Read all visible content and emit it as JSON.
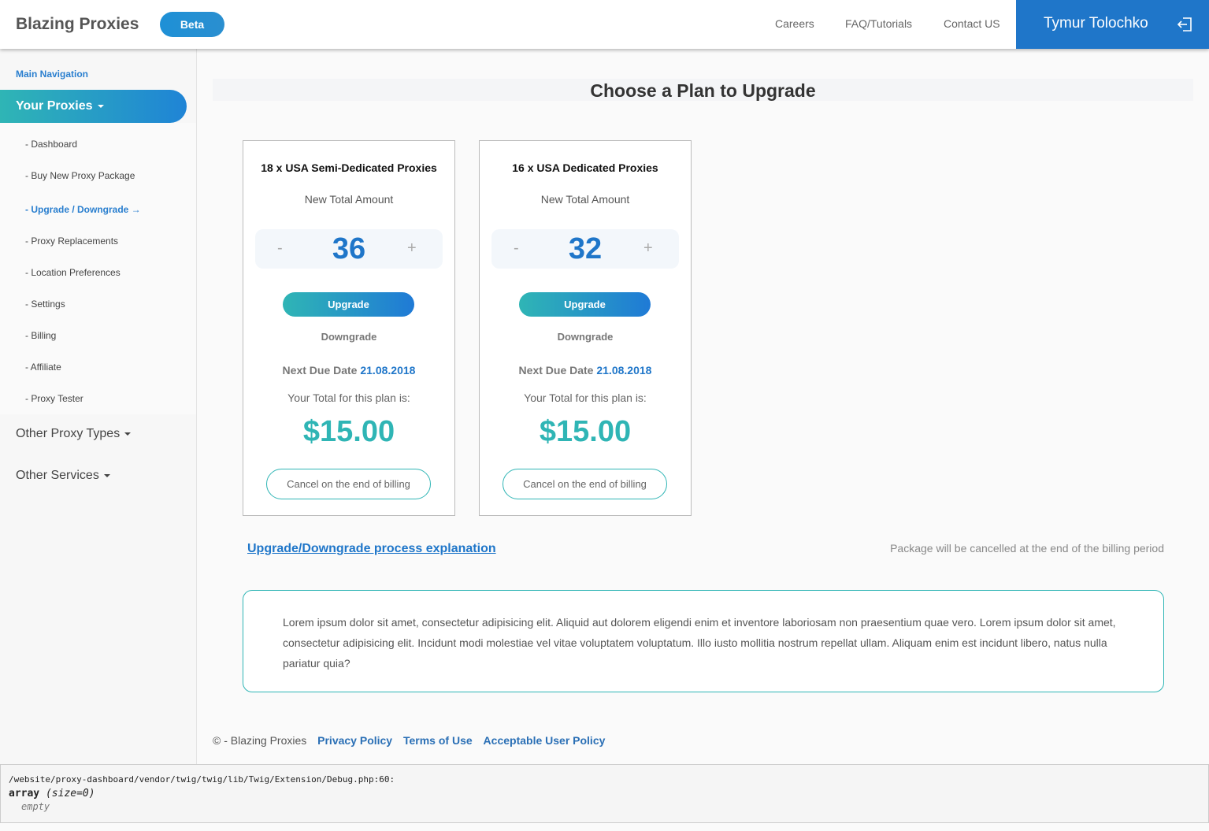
{
  "header": {
    "brand": "Blazing Proxies",
    "badge": "Beta",
    "nav": [
      "Careers",
      "FAQ/Tutorials",
      "Contact US"
    ],
    "user_name": "Tymur Tolochko",
    "icon": "logout-icon"
  },
  "sidebar": {
    "heading": "Main Navigation",
    "active_group": "Your Proxies",
    "items": [
      {
        "label": "- Dashboard"
      },
      {
        "label": "- Buy New Proxy Package"
      },
      {
        "label": "- Upgrade / Downgrade →"
      },
      {
        "label": "- Proxy Replacements"
      },
      {
        "label": "- Location Preferences"
      },
      {
        "label": "- Settings"
      },
      {
        "label": "- Billing"
      },
      {
        "label": "- Affiliate"
      },
      {
        "label": "- Proxy Tester"
      }
    ],
    "groups": [
      "Other Proxy Types",
      "Other Services"
    ]
  },
  "main": {
    "title": "Choose a Plan to Upgrade",
    "plans": [
      {
        "title": "18 x USA Semi-Dedicated Proxies",
        "subtitle": "New Total Amount",
        "minus": "-",
        "value": "36",
        "plus": "+",
        "upgrade": "Upgrade",
        "downgrade": "Downgrade",
        "due_label": "Next Due Date",
        "due_date": "21.08.2018",
        "total_label": "Your Total for this plan is:",
        "price": "$15.00",
        "cancel": "Cancel on the end of billing"
      },
      {
        "title": "16 x USA Dedicated Proxies",
        "subtitle": "New Total Amount",
        "minus": "-",
        "value": "32",
        "plus": "+",
        "upgrade": "Upgrade",
        "downgrade": "Downgrade",
        "due_label": "Next Due Date",
        "due_date": "21.08.2018",
        "total_label": "Your Total for this plan is:",
        "price": "$15.00",
        "cancel": "Cancel on the end of billing"
      }
    ],
    "explain_link": "Upgrade/Downgrade process explanation",
    "cancel_note": "Package will be cancelled at the end of the billing period",
    "info_text": "Lorem ipsum dolor sit amet, consectetur adipisicing elit. Aliquid aut dolorem eligendi enim et inventore laboriosam non praesentium quae vero. Lorem ipsum dolor sit amet, consectetur adipisicing elit. Incidunt modi molestiae vel vitae voluptatem voluptatum. Illo iusto mollitia nostrum repellat ullam. Aliquam enim est incidunt libero, natus nulla pariatur quia?"
  },
  "footer": {
    "copyright": "© - Blazing Proxies",
    "links": [
      "Privacy Policy",
      "Terms of Use",
      "Acceptable User Policy"
    ]
  },
  "debug": {
    "path": "/website/proxy-dashboard/vendor/twig/twig/lib/Twig/Extension/Debug.php:60:",
    "type": "array",
    "size": "(size=0)",
    "empty": "empty"
  },
  "colors": {
    "primary": "#1f76c9",
    "accent": "#2fb5b5"
  }
}
